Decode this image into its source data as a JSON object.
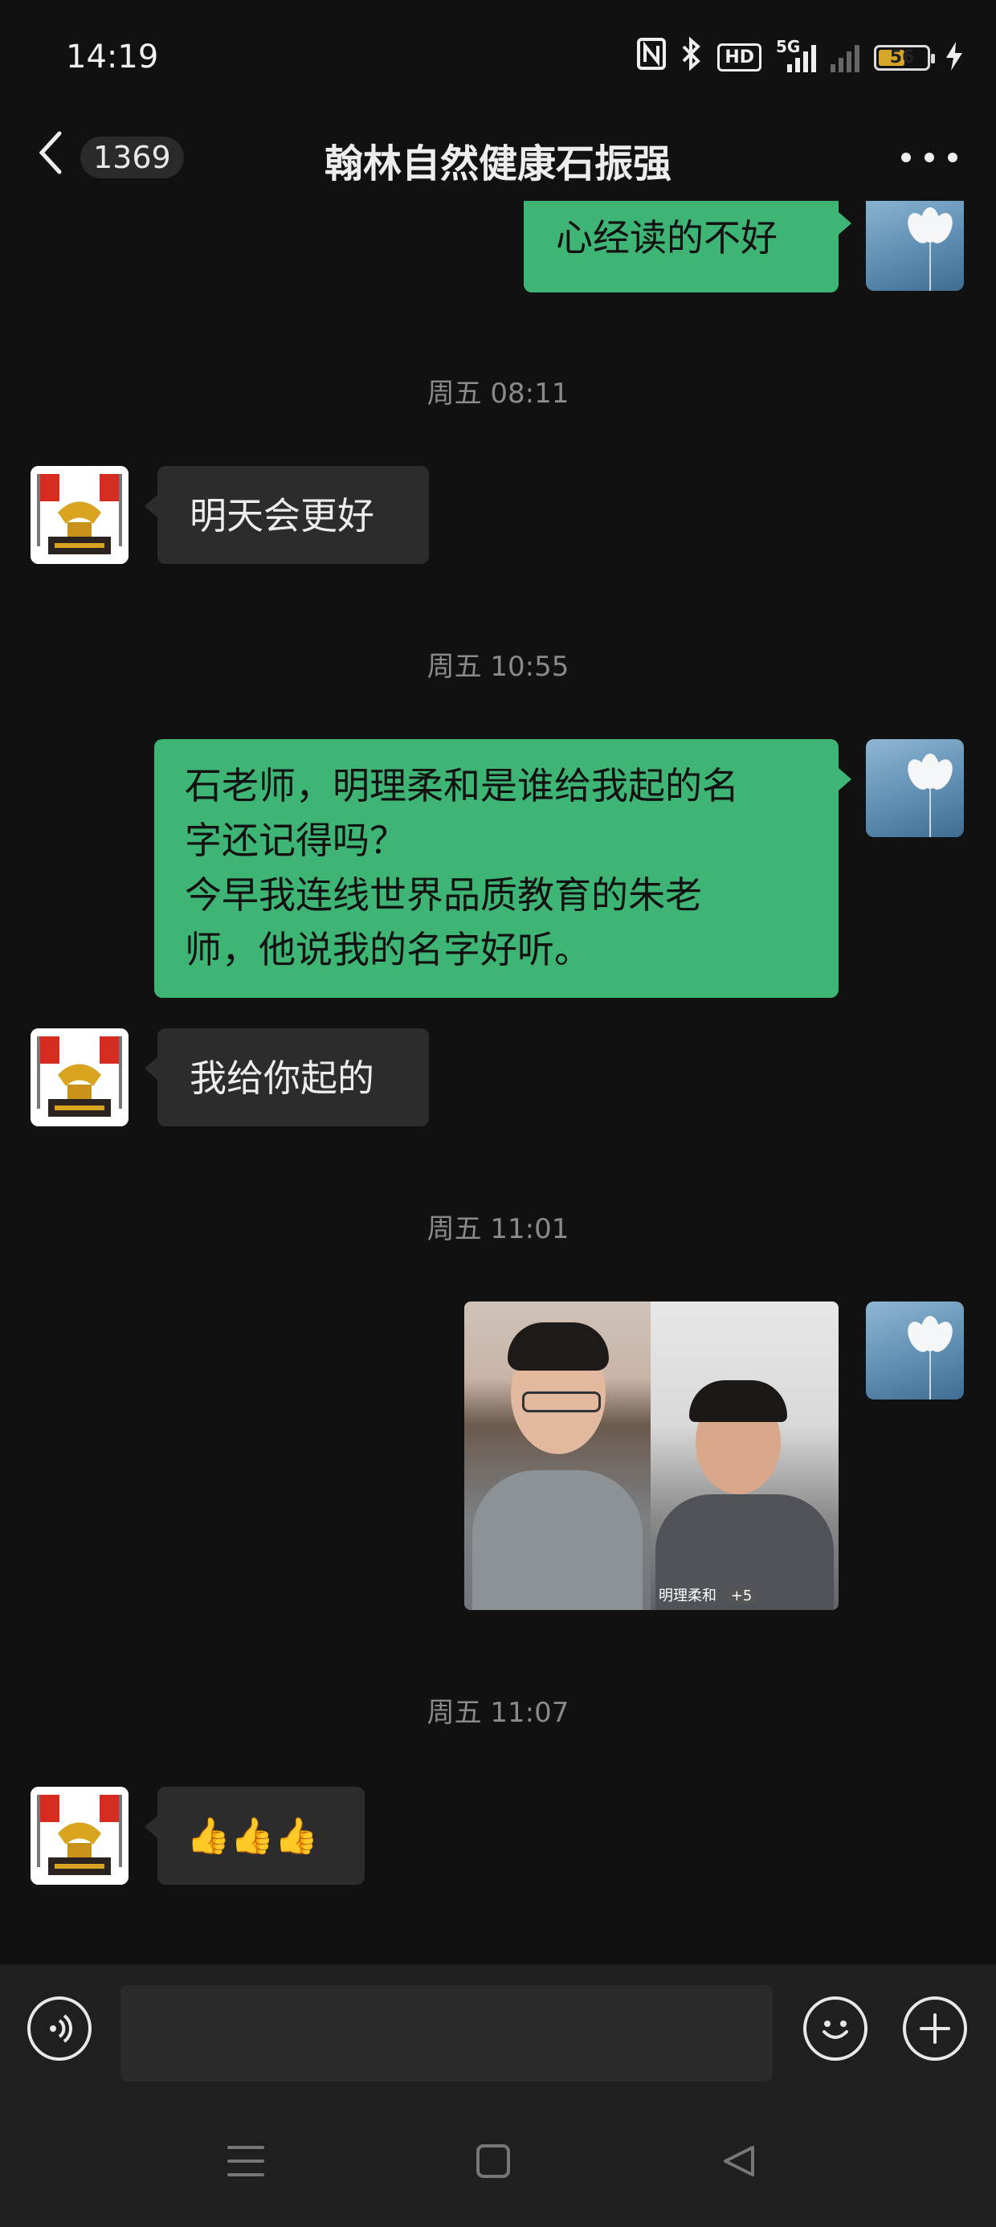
{
  "status_bar": {
    "time": "14:19",
    "network": "5G",
    "hd_label": "HD",
    "battery_level": "56",
    "battery_fraction": 0.56
  },
  "header": {
    "back_count": "1369",
    "title": "翰林自然健康石振强"
  },
  "messages": [
    {
      "side": "right",
      "type": "text",
      "text": "心经读的不好"
    },
    {
      "type": "timestamp",
      "text": "周五 08:11"
    },
    {
      "side": "left",
      "type": "text",
      "text": "明天会更好"
    },
    {
      "type": "timestamp",
      "text": "周五 10:55"
    },
    {
      "side": "right",
      "type": "text",
      "lines": [
        "石老师，明理柔和是谁给我起的名",
        "字还记得吗？",
        "今早我连线世界品质教育的朱老",
        "师，他说我的名字好听。"
      ]
    },
    {
      "side": "left",
      "type": "text",
      "text": "我给你起的"
    },
    {
      "type": "timestamp",
      "text": "周五 11:01"
    },
    {
      "side": "right",
      "type": "image",
      "caption": "明理柔和",
      "caption_badge": "+5"
    },
    {
      "type": "timestamp",
      "text": "周五 11:07"
    },
    {
      "side": "left",
      "type": "emoji",
      "text": "👍👍👍"
    }
  ],
  "colors": {
    "background": "#111111",
    "sent_bubble": "#3eb575",
    "received_bubble": "#2c2c2c",
    "timestamp": "#8a8a8a"
  },
  "icons": {
    "voice": "voice-icon",
    "emoji": "emoji-icon",
    "plus": "plus-icon",
    "back": "back-chevron-icon",
    "more": "more-dots-icon"
  }
}
